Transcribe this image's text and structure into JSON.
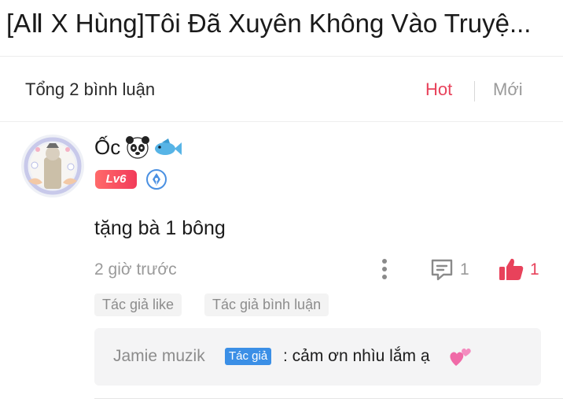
{
  "header": {
    "title": "[AⅡ X Hùng]Tôi Đã Xuyên Không Vào Truyệ..."
  },
  "comments_summary": {
    "total_label": "Tổng 2 bình luận",
    "sort_hot": "Hot",
    "sort_new": "Mới",
    "active_sort": "Hot"
  },
  "comment": {
    "username": "Ốc",
    "name_emojis": [
      "panda-icon",
      "fish-icon"
    ],
    "level": "Lv6",
    "text": "tặng bà 1 bông",
    "time": "2 giờ trước",
    "reply_count": "1",
    "like_count": "1",
    "tags": [
      "Tác giả like",
      "Tác giả bình luận"
    ],
    "reply": {
      "author": "Jamie muzik",
      "badge": "Tác giả",
      "text": ": cảm ơn nhìu lắm ạ",
      "emoji": "two-hearts-icon"
    }
  },
  "colors": {
    "accent": "#e8425b",
    "badge_blue": "#3b8fe6",
    "muted": "#9a9a9a"
  }
}
